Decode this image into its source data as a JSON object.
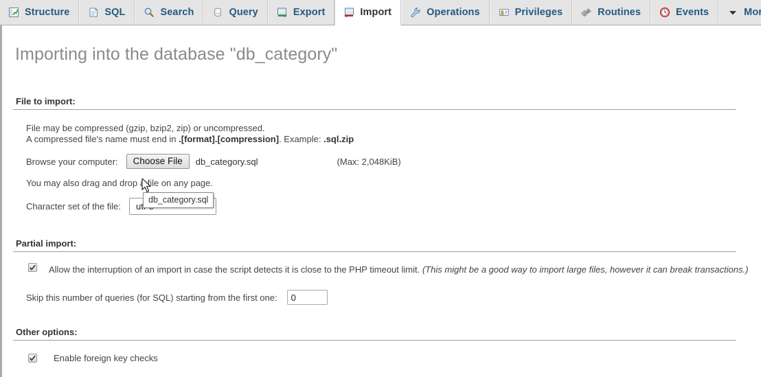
{
  "tabs": [
    {
      "id": "structure",
      "label": "Structure",
      "icon": "structure-icon",
      "active": false
    },
    {
      "id": "sql",
      "label": "SQL",
      "icon": "sql-icon",
      "active": false
    },
    {
      "id": "search",
      "label": "Search",
      "icon": "search-icon",
      "active": false
    },
    {
      "id": "query",
      "label": "Query",
      "icon": "query-icon",
      "active": false
    },
    {
      "id": "export",
      "label": "Export",
      "icon": "export-icon",
      "active": false
    },
    {
      "id": "import",
      "label": "Import",
      "icon": "import-icon",
      "active": true
    },
    {
      "id": "operations",
      "label": "Operations",
      "icon": "wrench-icon",
      "active": false
    },
    {
      "id": "privileges",
      "label": "Privileges",
      "icon": "privileges-icon",
      "active": false
    },
    {
      "id": "routines",
      "label": "Routines",
      "icon": "routines-icon",
      "active": false
    },
    {
      "id": "events",
      "label": "Events",
      "icon": "clock-icon",
      "active": false
    },
    {
      "id": "more",
      "label": "More",
      "icon": "chevron-down-icon",
      "active": false
    }
  ],
  "page": {
    "title": "Importing into the database \"db_category\""
  },
  "file_to_import": {
    "legend": "File to import:",
    "line1": "File may be compressed (gzip, bzip2, zip) or uncompressed.",
    "line2_prefix": "A compressed file's name must end in ",
    "line2_bold1": ".[format].[compression]",
    "line2_mid": ". Example: ",
    "line2_bold2": ".sql.zip",
    "browse_label": "Browse your computer:",
    "choose_file_button": "Choose File",
    "selected_file": "db_category.sql",
    "max_size": "(Max: 2,048KiB)",
    "dragdrop_text": "You may also drag and drop a file on any page.",
    "charset_label": "Character set of the file:",
    "charset_value": "utf-8"
  },
  "tooltip": {
    "text": "db_category.sql"
  },
  "partial_import": {
    "legend": "Partial import:",
    "allow_interruption_checked": true,
    "allow_interruption_text": "Allow the interruption of an import in case the script detects it is close to the PHP timeout limit. ",
    "allow_interruption_italic": "(This might be a good way to import large files, however it can break transactions.)",
    "skip_label": "Skip this number of queries (for SQL) starting from the first one:",
    "skip_value": "0"
  },
  "other_options": {
    "legend": "Other options:",
    "foreign_key_checked": true,
    "foreign_key_label": "Enable foreign key checks"
  },
  "colors": {
    "tab_link": "#235a81",
    "title": "#8a8a8a",
    "legend_rule": "#9d9d9d",
    "tabbar_bg": "#e5e5e5",
    "active_tab_bg": "#ffffff"
  }
}
